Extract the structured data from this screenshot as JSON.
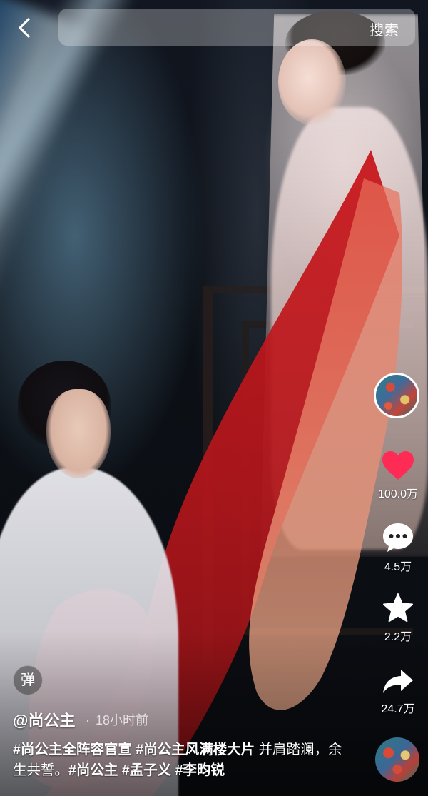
{
  "top_bar": {
    "back_icon": "chevron-left-icon",
    "search_placeholder": "",
    "search_button": "搜索"
  },
  "sidebar": {
    "music_disc_icon": "music-disc-icon",
    "like": {
      "icon": "heart-icon",
      "count": "100.0万",
      "color": "#fe2c55"
    },
    "comment": {
      "icon": "comment-icon",
      "count": "4.5万"
    },
    "favorite": {
      "icon": "star-icon",
      "count": "2.2万"
    },
    "share": {
      "icon": "share-arrow-icon",
      "count": "24.7万"
    }
  },
  "video": {
    "danmu_label": "弹",
    "author": "@尚公主",
    "time_separator": "·",
    "time": "18小时前",
    "caption_parts": [
      {
        "text": "#尚公主全阵容官宣",
        "tag": true
      },
      {
        "text": " ",
        "tag": false
      },
      {
        "text": "#尚公主风满楼大片",
        "tag": true
      },
      {
        "text": " 并肩踏澜，余生共誓。",
        "tag": false
      },
      {
        "text": "#尚公主",
        "tag": true
      },
      {
        "text": " ",
        "tag": false
      },
      {
        "text": "#孟子义",
        "tag": true
      },
      {
        "text": " ",
        "tag": false
      },
      {
        "text": "#李昀锐",
        "tag": true
      }
    ]
  }
}
